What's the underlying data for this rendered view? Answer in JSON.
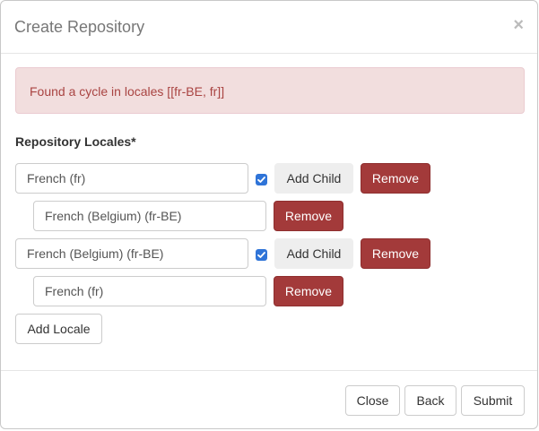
{
  "dialog": {
    "title": "Create Repository",
    "close_glyph": "×"
  },
  "alert": {
    "message": "Found a cycle in locales [[fr-BE, fr]]"
  },
  "locales_label": "Repository Locales*",
  "locale_rows": [
    {
      "value": "French (fr)",
      "checked": true,
      "add_child_label": "Add Child",
      "remove_label": "Remove",
      "child": {
        "value": "French (Belgium) (fr-BE)",
        "remove_label": "Remove"
      }
    },
    {
      "value": "French (Belgium) (fr-BE)",
      "checked": true,
      "add_child_label": "Add Child",
      "remove_label": "Remove",
      "child": {
        "value": "French (fr)",
        "remove_label": "Remove"
      }
    }
  ],
  "add_locale_label": "Add Locale",
  "footer": {
    "close_label": "Close",
    "back_label": "Back",
    "submit_label": "Submit"
  },
  "colors": {
    "alert_bg": "#f2dede",
    "alert_text": "#a94442",
    "danger_button": "#a33a3a",
    "checkbox": "#2f74d8"
  }
}
